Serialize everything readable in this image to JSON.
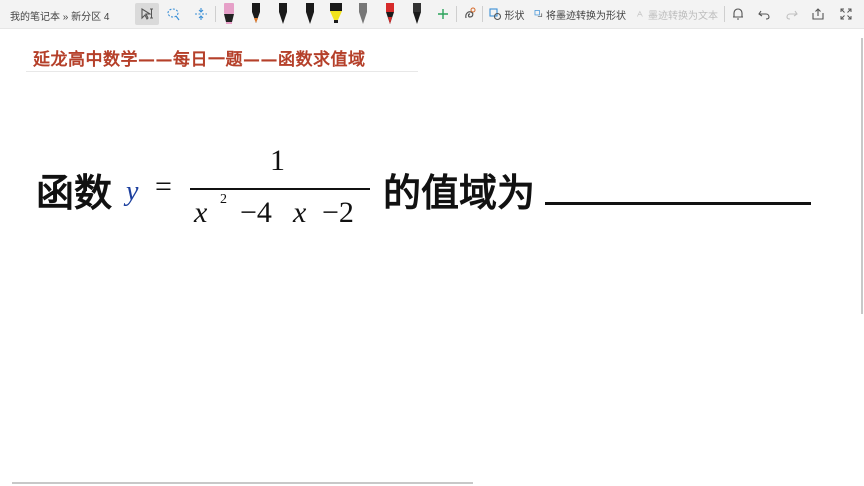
{
  "breadcrumb": "我的笔记本 » 新分区 4",
  "toolbar": {
    "pen_colors": [
      "#e6a0c8",
      "#222222",
      "#111111",
      "#111111",
      "#f2e31c",
      "#888888",
      "#d62a2a",
      "#333333"
    ],
    "shape_label": "形状",
    "ink_to_shape_label": "将墨迹转换为形状",
    "ink_to_text_label": "墨迹转换为文本"
  },
  "note": {
    "title": "延龙高中数学——每日一题——函数求值域",
    "problem": {
      "prefix": "函数",
      "lhs": "y",
      "equals": "=",
      "numerator": "1",
      "denominator": {
        "x": "x",
        "exponent": "2",
        "middle": "−4",
        "x2": "x",
        "tail": "−2"
      },
      "suffix": "的值域为"
    }
  }
}
